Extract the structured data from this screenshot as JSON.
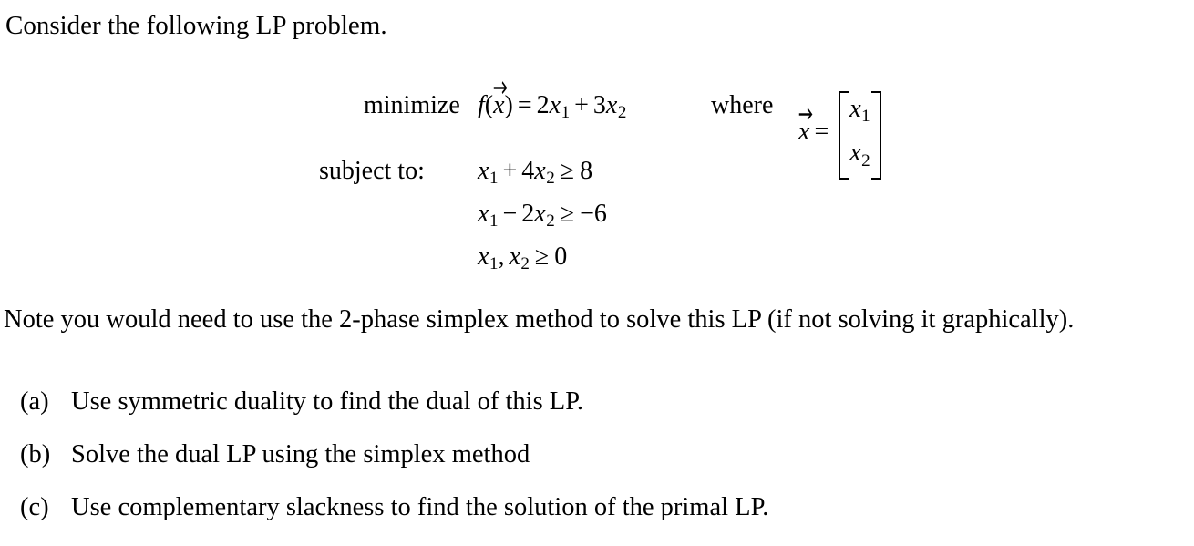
{
  "document": {
    "intro": "Consider the following LP problem.",
    "note": "Note you would need to use the 2-phase simplex method to solve this LP (if not solving it graphically).",
    "background_color": "#ffffff",
    "text_color": "#000000"
  },
  "lp_problem": {
    "objective_label": "minimize",
    "constraints_label": "subject to:",
    "where_label": "where",
    "objective": {
      "function_name": "f",
      "variable": "x",
      "equals": "=",
      "coefficient_1": "2",
      "term_1_var": "x",
      "term_1_sub": "1",
      "plus": "+",
      "coefficient_2": "3",
      "term_2_var": "x",
      "term_2_sub": "2",
      "full_text": "f(x) = 2x1 + 3x2"
    },
    "vector": {
      "symbol": "x",
      "equals": "=",
      "row_1_var": "x",
      "row_1_sub": "1",
      "row_2_var": "x",
      "row_2_sub": "2"
    },
    "constraint_1": {
      "var_1": "x",
      "sub_1": "1",
      "operator_1": "+",
      "coefficient_2": "4",
      "var_2": "x",
      "sub_2": "2",
      "relation": "≥",
      "rhs": "8",
      "full_text": "x1 + 4x2 >= 8"
    },
    "constraint_2": {
      "var_1": "x",
      "sub_1": "1",
      "operator_1": "−",
      "coefficient_2": "2",
      "var_2": "x",
      "sub_2": "2",
      "relation": "≥",
      "rhs": "−6",
      "full_text": "x1 - 2x2 >= -6"
    },
    "constraint_3": {
      "var_1": "x",
      "sub_1": "1",
      "comma": ",",
      "var_2": "x",
      "sub_2": "2",
      "relation": "≥",
      "rhs": "0",
      "full_text": "x1, x2 >= 0"
    }
  },
  "questions": [
    {
      "marker": "(a)",
      "text": "Use symmetric duality to find the dual of this LP."
    },
    {
      "marker": "(b)",
      "text": "Solve the dual LP using the simplex method"
    },
    {
      "marker": "(c)",
      "text": "Use complementary slackness to find the solution of the primal LP."
    }
  ]
}
